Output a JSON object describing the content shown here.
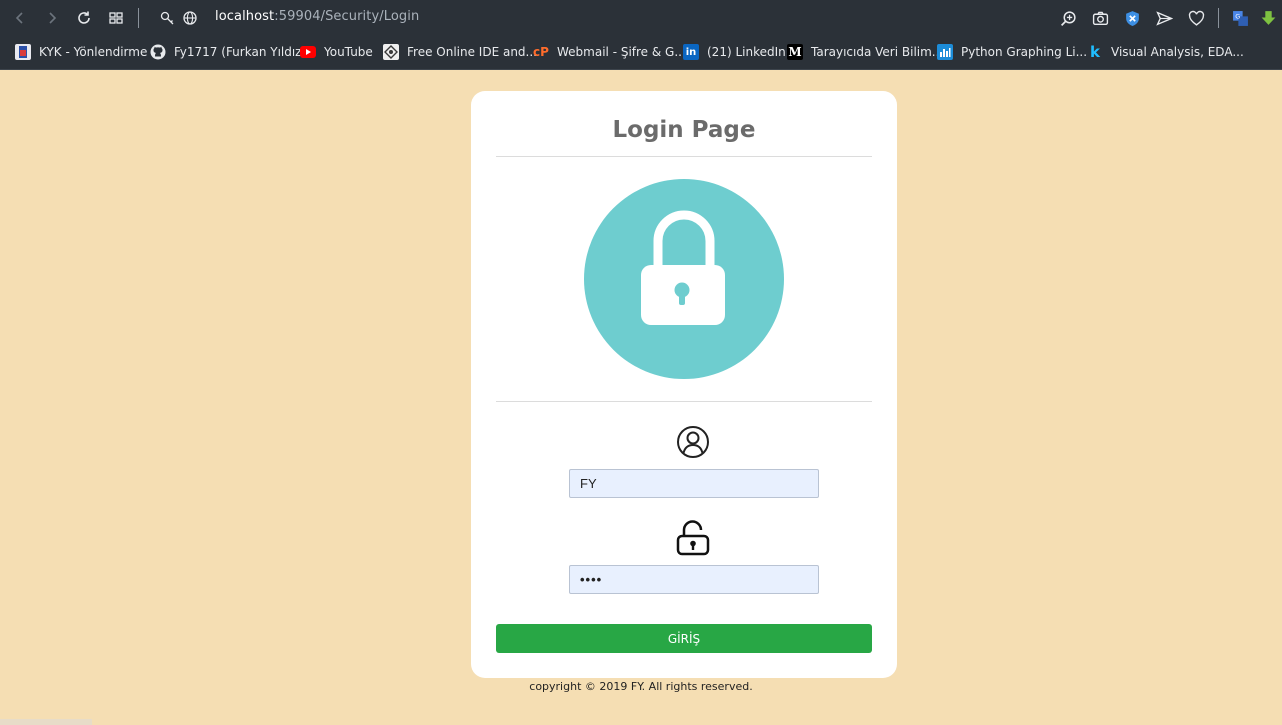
{
  "browser": {
    "url_host": "localhost",
    "url_rest": ":59904/Security/Login",
    "bookmarks": [
      {
        "label": "KYK - Yönlendirme"
      },
      {
        "label": "Fy1717 (Furkan Yıldız)"
      },
      {
        "label": "YouTube"
      },
      {
        "label": "Free Online IDE and..."
      },
      {
        "label": "Webmail - Şifre & G..."
      },
      {
        "label": "(21) LinkedIn"
      },
      {
        "label": "Tarayıcıda Veri Bilim..."
      },
      {
        "label": "Python Graphing Li..."
      },
      {
        "label": "Visual Analysis, EDA..."
      }
    ]
  },
  "login": {
    "title": "Login Page",
    "username_value": "FY",
    "password_value": "••••",
    "submit_label": "GİRİŞ"
  },
  "footer": {
    "text": "copyright © 2019 FY. All rights reserved."
  },
  "colors": {
    "page_bg": "#f5deb3",
    "lock_circle": "#6ecdcf",
    "button": "#28a745",
    "input_bg": "#e8f0fe"
  }
}
